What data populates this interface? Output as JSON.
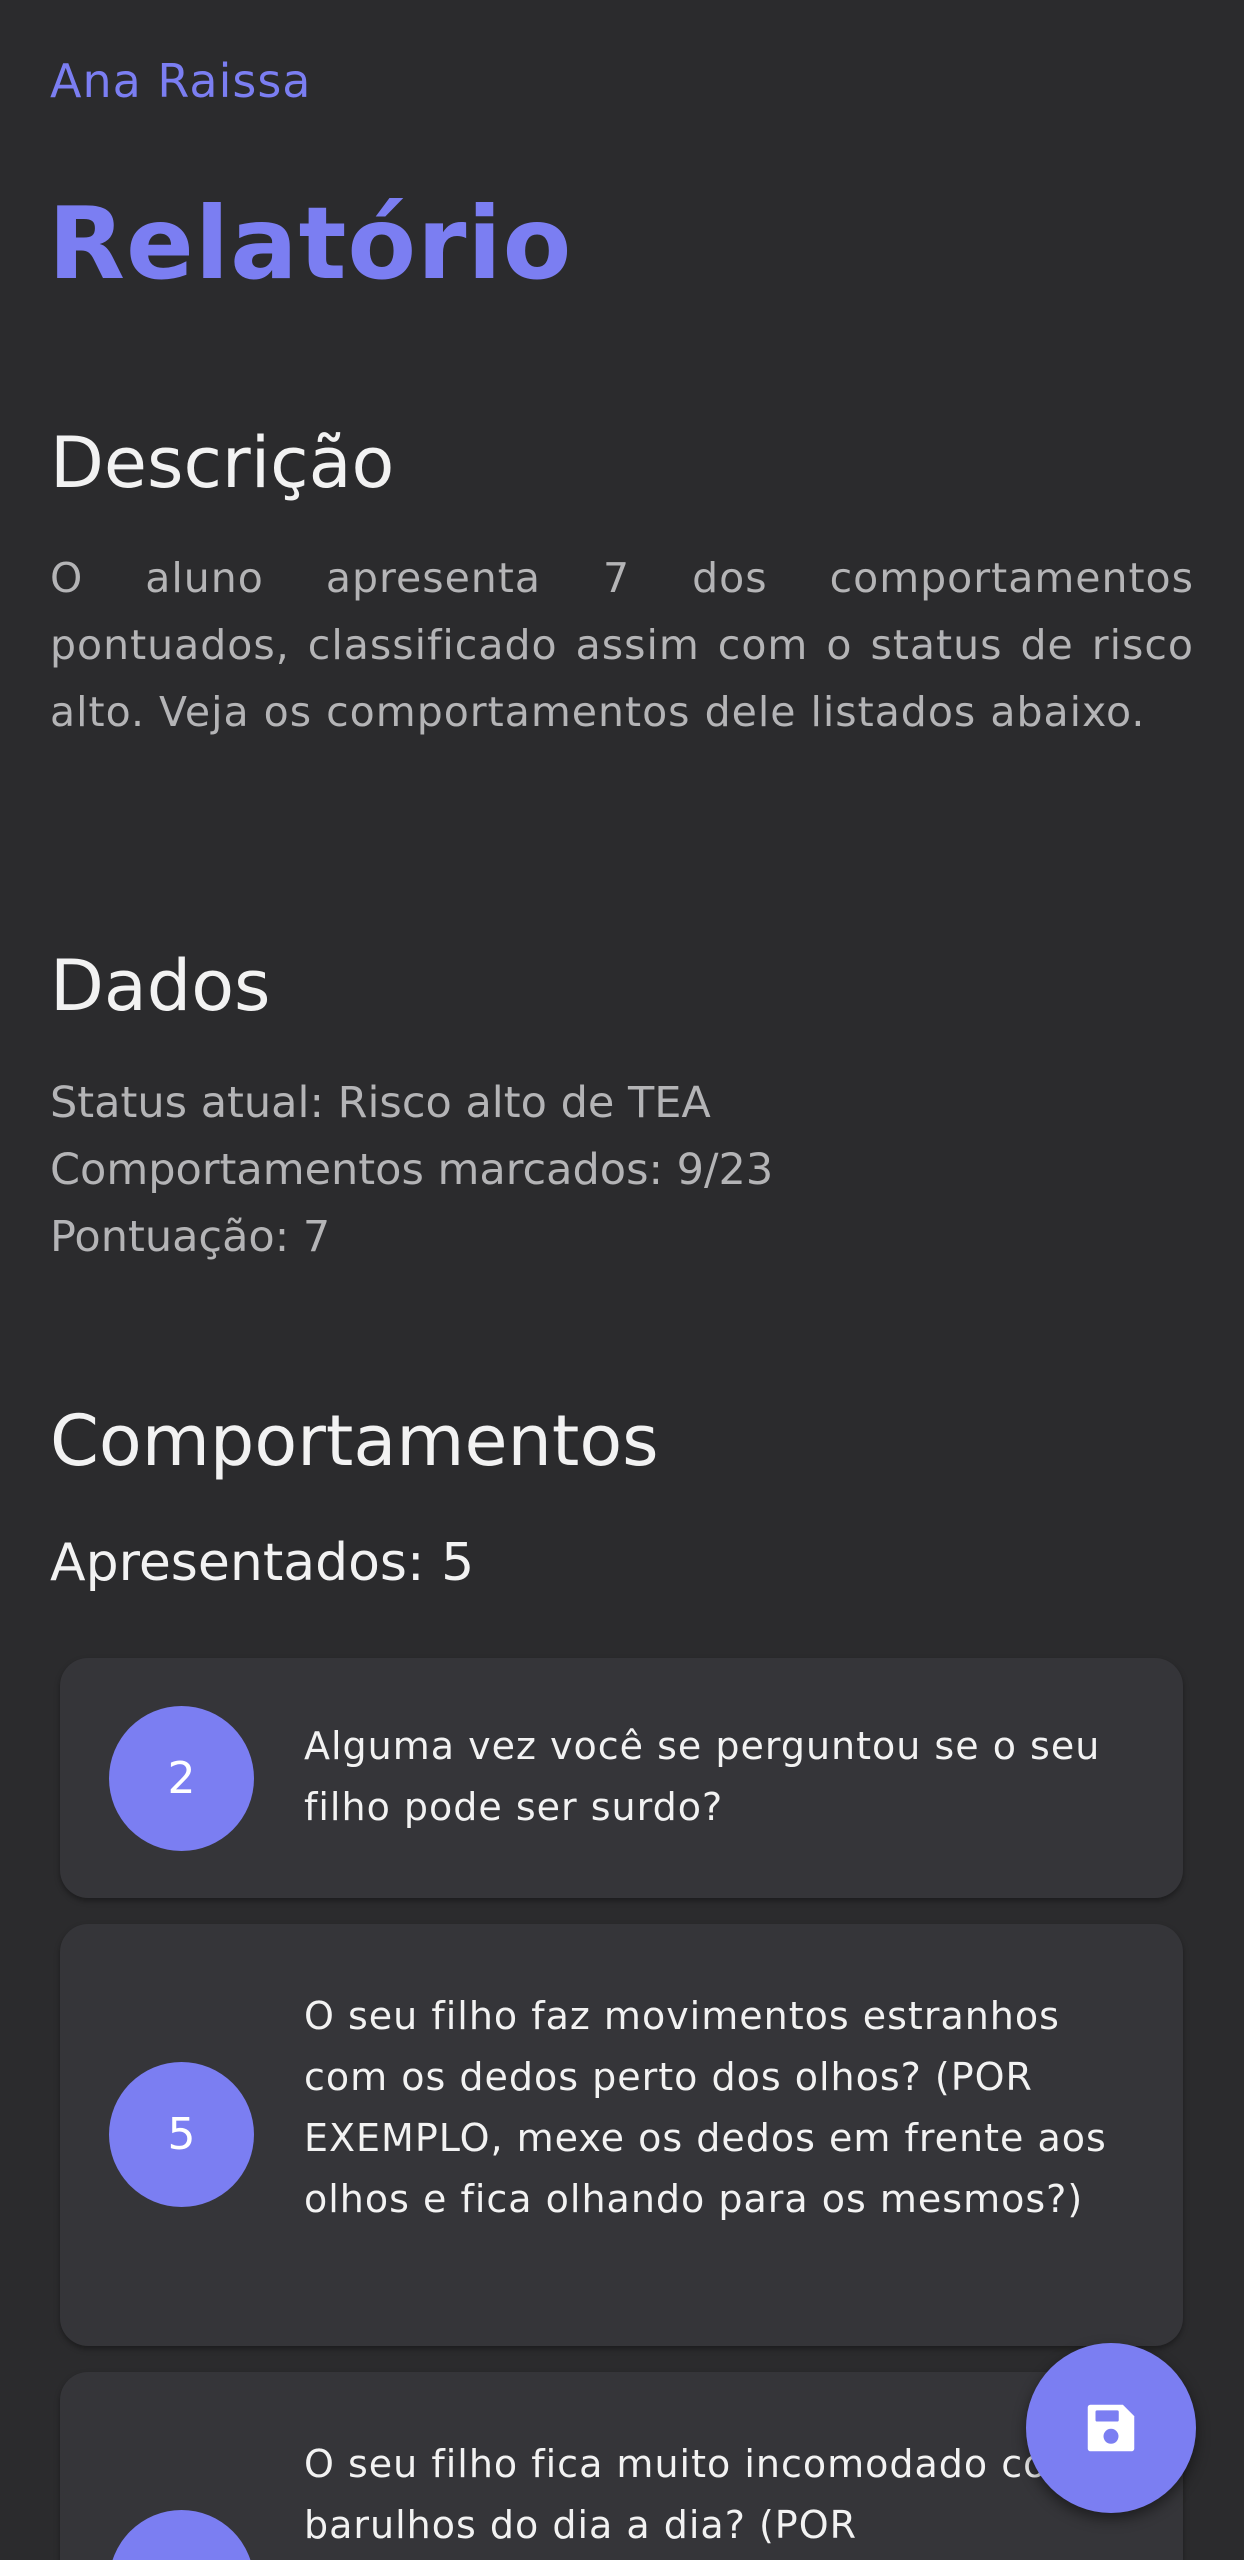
{
  "header": {
    "user_name": "Ana Raissa",
    "title": "Relatório"
  },
  "description": {
    "heading": "Descrição",
    "text": "O aluno apresenta 7 dos comportamentos pontuados, classificado assim com o status de risco alto. Veja os comportamentos dele listados abaixo."
  },
  "data": {
    "heading": "Dados",
    "lines": [
      "Status atual: Risco alto de TEA",
      "Comportamentos marcados: 9/23",
      "Pontuação: 7"
    ]
  },
  "behaviors": {
    "heading": "Comportamentos",
    "presented_label": "Apresentados: 5",
    "items": [
      {
        "number": "2",
        "text": "Alguma vez você se perguntou se o seu filho pode ser surdo?"
      },
      {
        "number": "5",
        "text": "O seu filho faz movimentos estranhos com os dedos perto dos olhos? (POR EXEMPLO, mexe os dedos em frente aos olhos e fica olhando para os mesmos?)"
      },
      {
        "number": "",
        "text": "O seu filho fica muito incomodado com barulhos do dia a dia? (POR"
      }
    ]
  },
  "fab": {
    "icon": "save-icon"
  },
  "colors": {
    "accent": "#7b7ef2",
    "background": "#2b2b2d",
    "card": "#353539"
  }
}
